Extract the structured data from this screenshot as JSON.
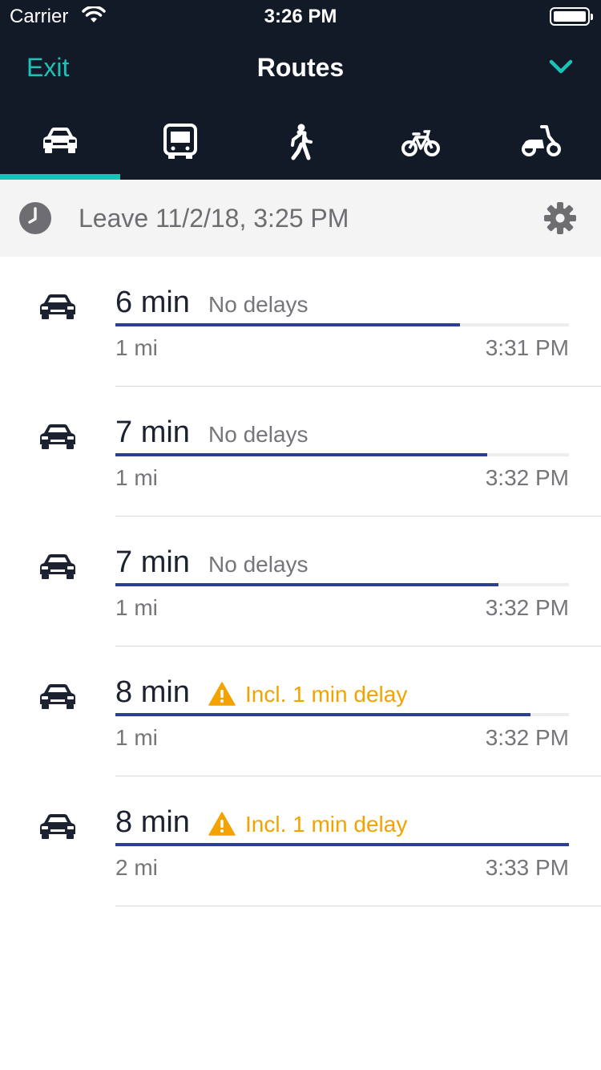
{
  "status": {
    "carrier": "Carrier",
    "time": "3:26 PM"
  },
  "nav": {
    "exit": "Exit",
    "title": "Routes"
  },
  "tabs": [
    {
      "mode": "car",
      "icon": "car-icon",
      "selected": true
    },
    {
      "mode": "transit",
      "icon": "bus-icon",
      "selected": false
    },
    {
      "mode": "walk",
      "icon": "pedestrian-icon",
      "selected": false
    },
    {
      "mode": "bike",
      "icon": "bicycle-icon",
      "selected": false
    },
    {
      "mode": "scooter",
      "icon": "scooter-icon",
      "selected": false
    }
  ],
  "leave": {
    "text": "Leave 11/2/18, 3:25 PM"
  },
  "routes": [
    {
      "duration": "6 min",
      "status": "No delays",
      "warning": false,
      "distance": "1 mi",
      "arrival": "3:31 PM",
      "progress": 0.76
    },
    {
      "duration": "7 min",
      "status": "No delays",
      "warning": false,
      "distance": "1 mi",
      "arrival": "3:32 PM",
      "progress": 0.82
    },
    {
      "duration": "7 min",
      "status": "No delays",
      "warning": false,
      "distance": "1 mi",
      "arrival": "3:32 PM",
      "progress": 0.845
    },
    {
      "duration": "8 min",
      "status": "Incl. 1 min delay",
      "warning": true,
      "distance": "1 mi",
      "arrival": "3:32 PM",
      "progress": 0.915
    },
    {
      "duration": "8 min",
      "status": "Incl. 1 min delay",
      "warning": true,
      "distance": "2 mi",
      "arrival": "3:33 PM",
      "progress": 1.0
    }
  ],
  "colors": {
    "accent": "#19c3b8",
    "header": "#121a28",
    "bar": "#2b3f94",
    "warning": "#f4a200"
  }
}
